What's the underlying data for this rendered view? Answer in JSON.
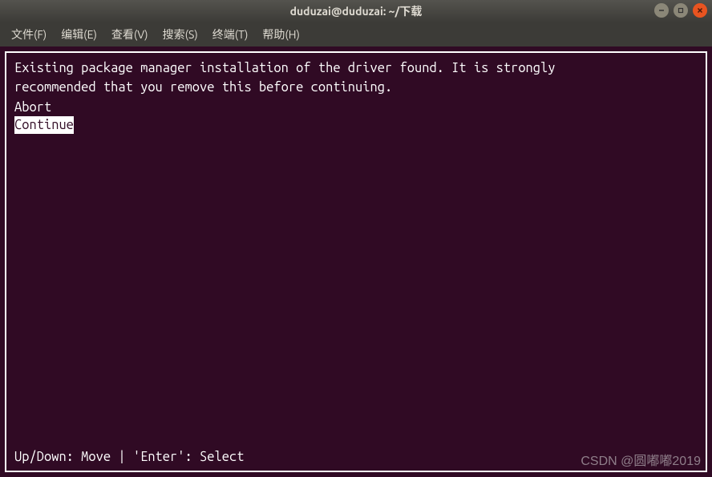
{
  "window": {
    "title": "duduzai@duduzai: ~/下载"
  },
  "menubar": {
    "items": [
      {
        "label": "文件(F)"
      },
      {
        "label": "编辑(E)"
      },
      {
        "label": "查看(V)"
      },
      {
        "label": "搜索(S)"
      },
      {
        "label": "终端(T)"
      },
      {
        "label": "帮助(H)"
      }
    ]
  },
  "terminal": {
    "message_line1": "Existing package manager installation of the driver found. It is strongly",
    "message_line2": "recommended that you remove this before continuing.",
    "options": [
      {
        "label": "Abort",
        "selected": false
      },
      {
        "label": "Continue",
        "selected": true
      }
    ],
    "footer": "Up/Down: Move | 'Enter': Select"
  },
  "watermark": "CSDN @圆嘟嘟2019"
}
